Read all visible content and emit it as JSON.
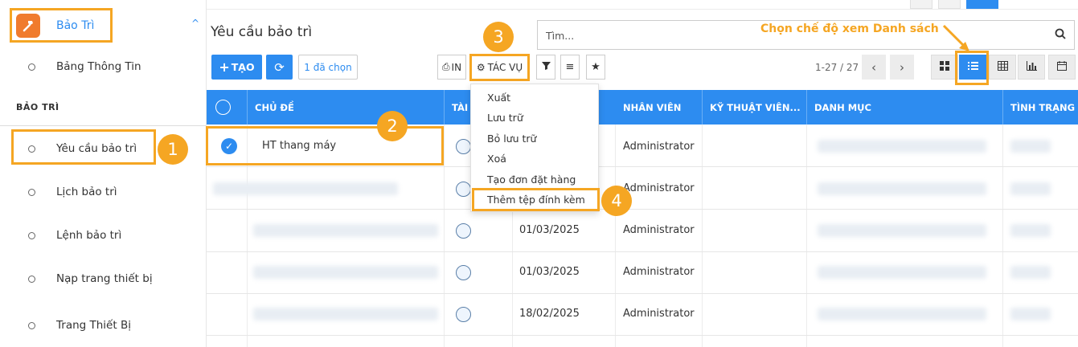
{
  "sidebar": {
    "app_title": "Bảo Trì",
    "items": [
      {
        "label": "Bảng Thông Tin"
      },
      {
        "label": "Yêu cầu bảo trì"
      },
      {
        "label": "Lịch bảo trì"
      },
      {
        "label": "Lệnh bảo trì"
      },
      {
        "label": "Nạp trang thiết bị"
      },
      {
        "label": "Trang Thiết Bị"
      }
    ],
    "section_label": "BẢO TRÌ"
  },
  "page_title": "Yêu cầu bảo trì",
  "toolbar": {
    "create_label": "TẠO",
    "selected_label": "1 đã chọn",
    "print_label": "IN",
    "actions_label": "TÁC VỤ"
  },
  "search": {
    "placeholder": "Tìm..."
  },
  "pager": {
    "text": "1-27 / 27"
  },
  "callout": "Chọn chế độ xem Danh sách",
  "badges": [
    "1",
    "2",
    "3",
    "4"
  ],
  "table": {
    "columns": [
      "CHỦ ĐỀ",
      "TÀI",
      "NHÂN VIÊN",
      "KỸ THUẬT VIÊN...",
      "DANH MỤC",
      "TÌNH TRẠNG"
    ],
    "rows": [
      {
        "subject": "HT thang máy",
        "date": "",
        "employee": "Administrator",
        "checked": true
      },
      {
        "subject": "",
        "date": "",
        "employee": "Administrator",
        "checked": false
      },
      {
        "subject": "",
        "date": "01/03/2025",
        "employee": "Administrator",
        "checked": false
      },
      {
        "subject": "",
        "date": "01/03/2025",
        "employee": "Administrator",
        "checked": false
      },
      {
        "subject": "",
        "date": "18/02/2025",
        "employee": "Administrator",
        "checked": false
      }
    ]
  },
  "actions_menu": [
    "Xuất",
    "Lưu trữ",
    "Bỏ lưu trữ",
    "Xoá",
    "Tạo đơn đặt hàng",
    "Thêm tệp đính kèm"
  ],
  "colors": {
    "accent": "#2d8cf0",
    "highlight": "#f5a623",
    "app_icon": "#f07b2d"
  }
}
